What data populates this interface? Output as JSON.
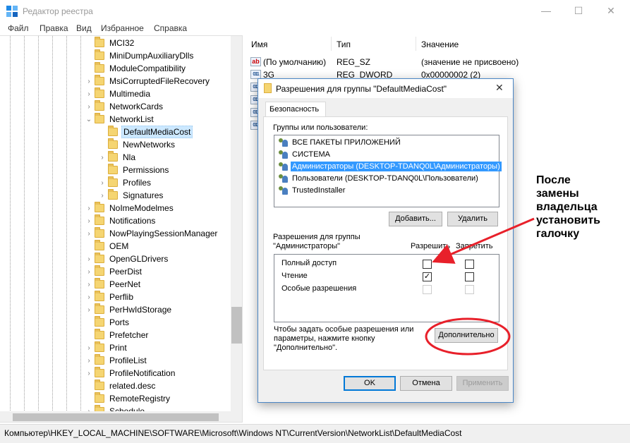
{
  "window": {
    "title": "Редактор реестра",
    "controls": {
      "minimize": "—",
      "maximize": "☐",
      "close": "✕"
    }
  },
  "menu": [
    "Файл",
    "Правка",
    "Вид",
    "Избранное",
    "Справка"
  ],
  "tree": {
    "items": [
      {
        "label": "MCI32",
        "level": 0,
        "expand": ""
      },
      {
        "label": "MiniDumpAuxiliaryDlls",
        "level": 0,
        "expand": ""
      },
      {
        "label": "ModuleCompatibility",
        "level": 0,
        "expand": ""
      },
      {
        "label": "MsiCorruptedFileRecovery",
        "level": 0,
        "expand": "›"
      },
      {
        "label": "Multimedia",
        "level": 0,
        "expand": "›"
      },
      {
        "label": "NetworkCards",
        "level": 0,
        "expand": "›"
      },
      {
        "label": "NetworkList",
        "level": 0,
        "expand": "⌄"
      },
      {
        "label": "DefaultMediaCost",
        "level": 1,
        "expand": "",
        "selected": true
      },
      {
        "label": "NewNetworks",
        "level": 1,
        "expand": ""
      },
      {
        "label": "Nla",
        "level": 1,
        "expand": "›"
      },
      {
        "label": "Permissions",
        "level": 1,
        "expand": ""
      },
      {
        "label": "Profiles",
        "level": 1,
        "expand": "›"
      },
      {
        "label": "Signatures",
        "level": 1,
        "expand": "›"
      },
      {
        "label": "NoImeModelmes",
        "level": 0,
        "expand": "›"
      },
      {
        "label": "Notifications",
        "level": 0,
        "expand": "›"
      },
      {
        "label": "NowPlayingSessionManager",
        "level": 0,
        "expand": "›"
      },
      {
        "label": "OEM",
        "level": 0,
        "expand": ""
      },
      {
        "label": "OpenGLDrivers",
        "level": 0,
        "expand": "›"
      },
      {
        "label": "PeerDist",
        "level": 0,
        "expand": "›"
      },
      {
        "label": "PeerNet",
        "level": 0,
        "expand": "›"
      },
      {
        "label": "Perflib",
        "level": 0,
        "expand": "›"
      },
      {
        "label": "PerHwIdStorage",
        "level": 0,
        "expand": "›"
      },
      {
        "label": "Ports",
        "level": 0,
        "expand": ""
      },
      {
        "label": "Prefetcher",
        "level": 0,
        "expand": ""
      },
      {
        "label": "Print",
        "level": 0,
        "expand": "›"
      },
      {
        "label": "ProfileList",
        "level": 0,
        "expand": "›"
      },
      {
        "label": "ProfileNotification",
        "level": 0,
        "expand": "›"
      },
      {
        "label": "related.desc",
        "level": 0,
        "expand": ""
      },
      {
        "label": "RemoteRegistry",
        "level": 0,
        "expand": ""
      },
      {
        "label": "Schedule",
        "level": 0,
        "expand": "›"
      }
    ]
  },
  "values": {
    "headers": {
      "name": "Имя",
      "type": "Тип",
      "data": "Значение"
    },
    "rows": [
      {
        "icon": "ab",
        "name": "(По умолчанию)",
        "type": "REG_SZ",
        "data": "(значение не присвоено)"
      },
      {
        "icon": "011",
        "name": "3G",
        "type": "REG_DWORD",
        "data": "0x00000002 (2)"
      },
      {
        "icon": "011",
        "name": "",
        "type": "",
        "data": ""
      },
      {
        "icon": "011",
        "name": "",
        "type": "",
        "data": ""
      },
      {
        "icon": "011",
        "name": "",
        "type": "",
        "data": ""
      },
      {
        "icon": "011",
        "name": "",
        "type": "",
        "data": ""
      }
    ]
  },
  "status": "Компьютер\\HKEY_LOCAL_MACHINE\\SOFTWARE\\Microsoft\\Windows NT\\CurrentVersion\\NetworkList\\DefaultMediaCost",
  "dialog": {
    "title": "Разрешения для группы \"DefaultMediaCost\"",
    "close": "✕",
    "tab": "Безопасность",
    "groups_label": "Группы или пользователи:",
    "users": [
      {
        "label": "ВСЕ ПАКЕТЫ ПРИЛОЖЕНИЙ"
      },
      {
        "label": "СИСТЕМА"
      },
      {
        "label": "Администраторы (DESKTOP-TDANQ0L\\Администраторы)",
        "selected": true
      },
      {
        "label": "Пользователи (DESKTOP-TDANQ0L\\Пользователи)"
      },
      {
        "label": "TrustedInstaller"
      }
    ],
    "add_button": "Добавить...",
    "remove_button": "Удалить",
    "perm_for_line1": "Разрешения для группы",
    "perm_for_line2": "\"Администраторы\"",
    "allow_header": "Разрешить",
    "deny_header": "Запретить",
    "permissions": [
      {
        "name": "Полный доступ",
        "allow": false,
        "deny": false,
        "disabled": false
      },
      {
        "name": "Чтение",
        "allow": true,
        "deny": false,
        "disabled": false
      },
      {
        "name": "Особые разрешения",
        "allow": false,
        "deny": false,
        "disabled": true
      }
    ],
    "hint_line1": "Чтобы задать особые разрешения или",
    "hint_line2": "параметры, нажмите кнопку",
    "hint_line3": "\"Дополнительно\".",
    "advanced_button": "Дополнительно",
    "ok_button": "OK",
    "cancel_button": "Отмена",
    "apply_button": "Применить"
  },
  "annotation": {
    "lines": [
      "После",
      "замены",
      "владельца",
      "установить",
      "галочку"
    ],
    "color": "#e8202a"
  }
}
